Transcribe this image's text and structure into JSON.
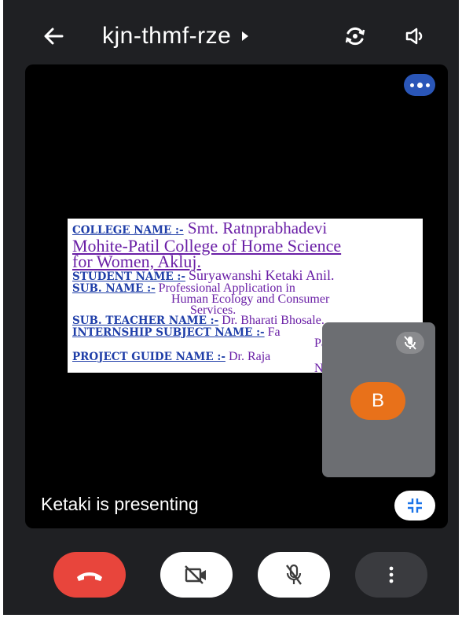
{
  "header": {
    "meeting_code": "kjn-thmf-rze",
    "icons": [
      "back-icon",
      "caret-right-icon",
      "switch-camera-icon",
      "speaker-icon"
    ]
  },
  "slide": {
    "college_label": "COLLEGE NAME :-",
    "college_value_1": "Smt. Ratnprabhadevi",
    "college_value_2": "Mohite-Patil College of Home Science",
    "college_value_3": "for Women, Akluj.",
    "student_label": "STUDENT NAME :-",
    "student_value": "Suryawanshi  Ketaki  Anil.",
    "subject_label": "SUB. NAME :-",
    "subject_value_1": "Professional Application in",
    "subject_value_2": "Human Ecology and Consumer",
    "subject_value_3": "Services.",
    "teacher_label": "SUB. TEACHER NAME :-",
    "teacher_value": "Dr. Bharati Bhosale.",
    "internship_label": "INTERNSHIP SUBJECT NAME :-",
    "internship_value_1": "Fa",
    "internship_value_2": "Pa",
    "guide_label": "PROJECT GUIDE NAME :-",
    "guide_value_1": "Dr. Raja",
    "guide_value_2": "Nim"
  },
  "self_tile": {
    "avatar_letter": "B"
  },
  "status": {
    "presenting_text": "Ketaki is presenting"
  },
  "colors": {
    "hangup": "#e8453c",
    "avatar": "#e8711a",
    "pill": "#2a56b8"
  }
}
